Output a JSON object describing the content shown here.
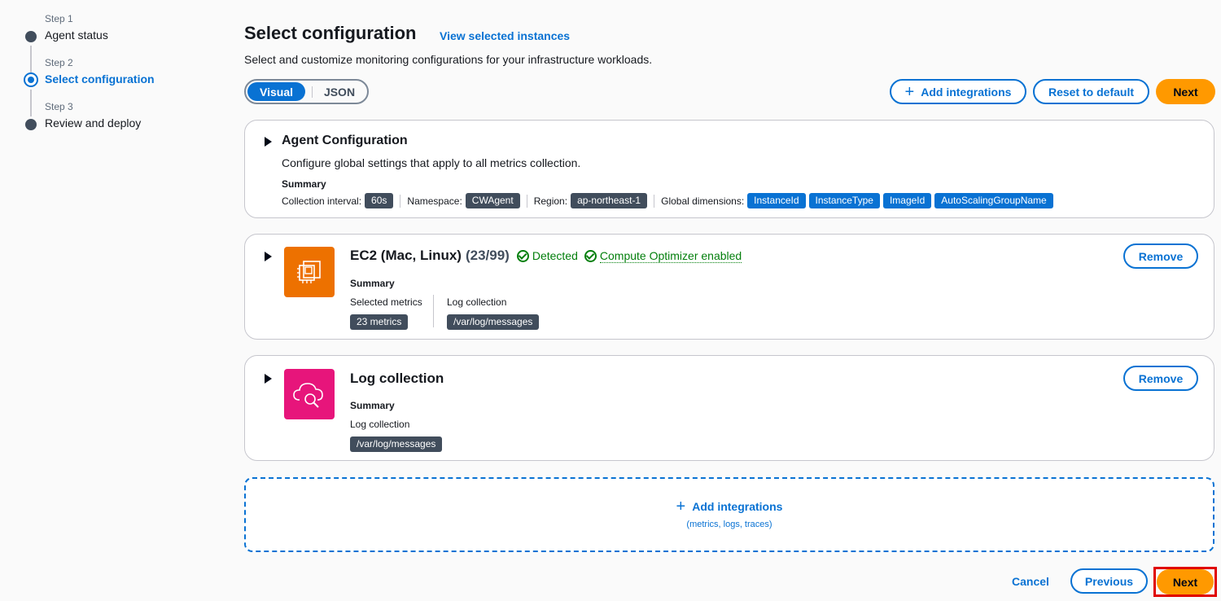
{
  "stepper": [
    {
      "num": "Step 1",
      "label": "Agent status"
    },
    {
      "num": "Step 2",
      "label": "Select configuration"
    },
    {
      "num": "Step 3",
      "label": "Review and deploy"
    }
  ],
  "header": {
    "title": "Select configuration",
    "view_link": "View selected instances",
    "subtitle": "Select and customize monitoring configurations for your infrastructure workloads."
  },
  "toggle": {
    "visual": "Visual",
    "json": "JSON"
  },
  "toolbar": {
    "add": "Add integrations",
    "reset": "Reset to default",
    "next": "Next"
  },
  "agent": {
    "title": "Agent Configuration",
    "desc": "Configure global settings that apply to all metrics collection.",
    "summary": "Summary",
    "interval_label": "Collection interval:",
    "interval": "60s",
    "namespace_label": "Namespace:",
    "namespace": "CWAgent",
    "region_label": "Region:",
    "region": "ap-northeast-1",
    "dims_label": "Global dimensions:",
    "dims": [
      "InstanceId",
      "InstanceType",
      "ImageId",
      "AutoScalingGroupName"
    ]
  },
  "ec2": {
    "title": "EC2 (Mac, Linux)",
    "count": "(23/99)",
    "detected": "Detected",
    "optimizer": "Compute Optimizer enabled",
    "summary": "Summary",
    "metrics_label": "Selected metrics",
    "metrics": "23 metrics",
    "log_label": "Log collection",
    "log": "/var/log/messages",
    "remove": "Remove"
  },
  "logs": {
    "title": "Log collection",
    "summary": "Summary",
    "log_label": "Log collection",
    "log": "/var/log/messages",
    "remove": "Remove"
  },
  "add_box": {
    "label": "Add integrations",
    "hint": "(metrics, logs, traces)"
  },
  "footer": {
    "cancel": "Cancel",
    "previous": "Previous",
    "next": "Next"
  },
  "colors": {
    "accent": "#0972d3",
    "primary": "#ff9900",
    "ec2": "#ed7100",
    "logs": "#e7157b",
    "success": "#037f0c"
  }
}
